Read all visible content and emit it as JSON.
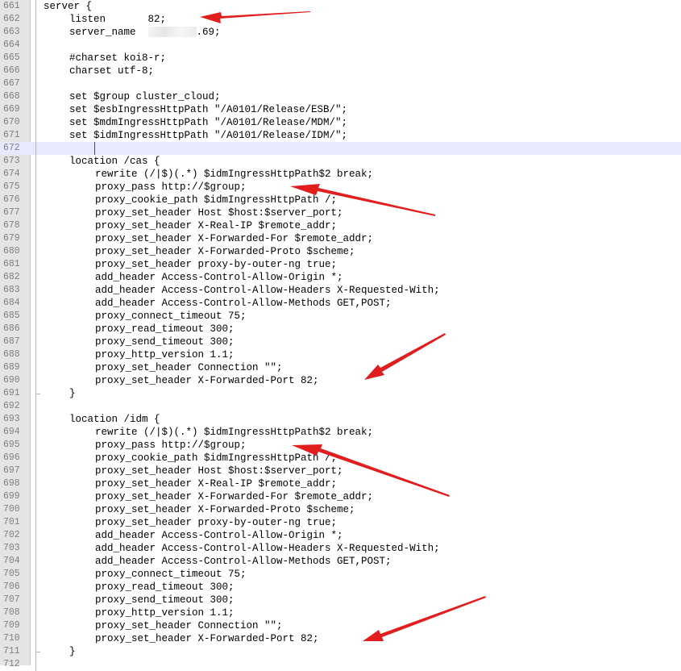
{
  "editor": {
    "current_line": "672",
    "lines": [
      {
        "n": "661",
        "indent": 1,
        "text": "server {"
      },
      {
        "n": "662",
        "indent": 2,
        "text": "listen       82;"
      },
      {
        "n": "663",
        "indent": 2,
        "text": "server_name  ",
        "redacted": true,
        "after": ".69;"
      },
      {
        "n": "664",
        "indent": 0,
        "text": ""
      },
      {
        "n": "665",
        "indent": 2,
        "text": "#charset koi8-r;"
      },
      {
        "n": "666",
        "indent": 2,
        "text": "charset utf-8;"
      },
      {
        "n": "667",
        "indent": 0,
        "text": ""
      },
      {
        "n": "668",
        "indent": 2,
        "text": "set $group cluster_cloud;"
      },
      {
        "n": "669",
        "indent": 2,
        "text": "set $esbIngressHttpPath \"/A0101/Release/ESB/\";"
      },
      {
        "n": "670",
        "indent": 2,
        "text": "set $mdmIngressHttpPath \"/A0101/Release/MDM/\";"
      },
      {
        "n": "671",
        "indent": 2,
        "text": "set $idmIngressHttpPath \"/A0101/Release/IDM/\";"
      },
      {
        "n": "672",
        "indent": 0,
        "text": ""
      },
      {
        "n": "673",
        "indent": 2,
        "text": "location /cas {"
      },
      {
        "n": "674",
        "indent": 3,
        "text": "rewrite (/|$)(.*) $idmIngressHttpPath$2 break;"
      },
      {
        "n": "675",
        "indent": 3,
        "text": "proxy_pass http://$group;"
      },
      {
        "n": "676",
        "indent": 3,
        "text": "proxy_cookie_path $idmIngressHttpPath /;"
      },
      {
        "n": "677",
        "indent": 3,
        "text": "proxy_set_header Host $host:$server_port;"
      },
      {
        "n": "678",
        "indent": 3,
        "text": "proxy_set_header X-Real-IP $remote_addr;"
      },
      {
        "n": "679",
        "indent": 3,
        "text": "proxy_set_header X-Forwarded-For $remote_addr;"
      },
      {
        "n": "680",
        "indent": 3,
        "text": "proxy_set_header X-Forwarded-Proto $scheme;"
      },
      {
        "n": "681",
        "indent": 3,
        "text": "proxy_set_header proxy-by-outer-ng true;"
      },
      {
        "n": "682",
        "indent": 3,
        "text": "add_header Access-Control-Allow-Origin *;"
      },
      {
        "n": "683",
        "indent": 3,
        "text": "add_header Access-Control-Allow-Headers X-Requested-With;"
      },
      {
        "n": "684",
        "indent": 3,
        "text": "add_header Access-Control-Allow-Methods GET,POST;"
      },
      {
        "n": "685",
        "indent": 3,
        "text": "proxy_connect_timeout 75;"
      },
      {
        "n": "686",
        "indent": 3,
        "text": "proxy_read_timeout 300;"
      },
      {
        "n": "687",
        "indent": 3,
        "text": "proxy_send_timeout 300;"
      },
      {
        "n": "688",
        "indent": 3,
        "text": "proxy_http_version 1.1;"
      },
      {
        "n": "689",
        "indent": 3,
        "text": "proxy_set_header Connection \"\";"
      },
      {
        "n": "690",
        "indent": 3,
        "text": "proxy_set_header X-Forwarded-Port 82;"
      },
      {
        "n": "691",
        "indent": 2,
        "text": "}"
      },
      {
        "n": "692",
        "indent": 0,
        "text": ""
      },
      {
        "n": "693",
        "indent": 2,
        "text": "location /idm {"
      },
      {
        "n": "694",
        "indent": 3,
        "text": "rewrite (/|$)(.*) $idmIngressHttpPath$2 break;"
      },
      {
        "n": "695",
        "indent": 3,
        "text": "proxy_pass http://$group;"
      },
      {
        "n": "696",
        "indent": 3,
        "text": "proxy_cookie_path $idmIngressHttpPath /;"
      },
      {
        "n": "697",
        "indent": 3,
        "text": "proxy_set_header Host $host:$server_port;"
      },
      {
        "n": "698",
        "indent": 3,
        "text": "proxy_set_header X-Real-IP $remote_addr;"
      },
      {
        "n": "699",
        "indent": 3,
        "text": "proxy_set_header X-Forwarded-For $remote_addr;"
      },
      {
        "n": "700",
        "indent": 3,
        "text": "proxy_set_header X-Forwarded-Proto $scheme;"
      },
      {
        "n": "701",
        "indent": 3,
        "text": "proxy_set_header proxy-by-outer-ng true;"
      },
      {
        "n": "702",
        "indent": 3,
        "text": "add_header Access-Control-Allow-Origin *;"
      },
      {
        "n": "703",
        "indent": 3,
        "text": "add_header Access-Control-Allow-Headers X-Requested-With;"
      },
      {
        "n": "704",
        "indent": 3,
        "text": "add_header Access-Control-Allow-Methods GET,POST;"
      },
      {
        "n": "705",
        "indent": 3,
        "text": "proxy_connect_timeout 75;"
      },
      {
        "n": "706",
        "indent": 3,
        "text": "proxy_read_timeout 300;"
      },
      {
        "n": "707",
        "indent": 3,
        "text": "proxy_send_timeout 300;"
      },
      {
        "n": "708",
        "indent": 3,
        "text": "proxy_http_version 1.1;"
      },
      {
        "n": "709",
        "indent": 3,
        "text": "proxy_set_header Connection \"\";"
      },
      {
        "n": "710",
        "indent": 3,
        "text": "proxy_set_header X-Forwarded-Port 82;"
      },
      {
        "n": "711",
        "indent": 2,
        "text": "}"
      },
      {
        "n": "712",
        "indent": 0,
        "text": ""
      }
    ]
  },
  "annotations": {
    "arrow_color": "#e11d1d",
    "highlight_color": "#e8e8ff"
  }
}
